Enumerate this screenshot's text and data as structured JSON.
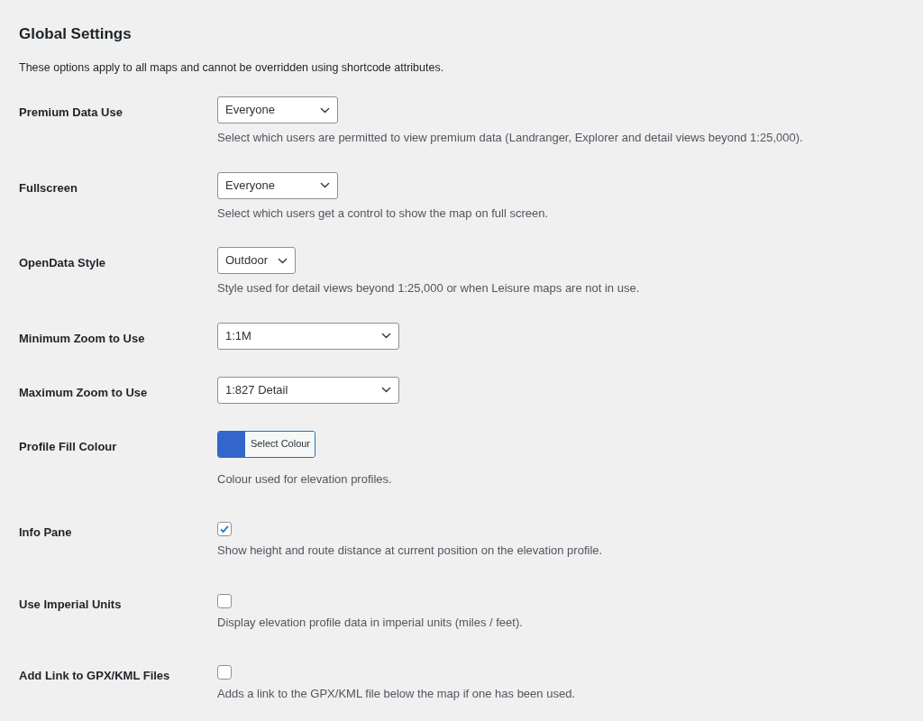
{
  "title": "Global Settings",
  "intro": "These options apply to all maps and cannot be overridden using shortcode attributes.",
  "settings": [
    {
      "kind": "select",
      "label": "Premium Data Use",
      "value": "Everyone",
      "description": "Select which users are permitted to view premium data (Landranger, Explorer and detail views beyond 1:25,000)."
    },
    {
      "kind": "select",
      "label": "Fullscreen",
      "value": "Everyone",
      "description": "Select which users get a control to show the map on full screen."
    },
    {
      "kind": "select",
      "label": "OpenData Style",
      "value": "Outdoor",
      "description": "Style used for detail views beyond 1:25,000 or when Leisure maps are not in use."
    },
    {
      "kind": "select",
      "label": "Minimum Zoom to Use",
      "value": "1:1M"
    },
    {
      "kind": "select",
      "label": "Maximum Zoom to Use",
      "value": "1:827 Detail"
    },
    {
      "kind": "color",
      "label": "Profile Fill Colour",
      "button": "Select Colour",
      "color": "#3366cc",
      "description": "Colour used for elevation profiles."
    },
    {
      "kind": "checkbox",
      "label": "Info Pane",
      "checked": true,
      "description": "Show height and route distance at current position on the elevation profile."
    },
    {
      "kind": "checkbox",
      "label": "Use Imperial Units",
      "checked": false,
      "description": "Display elevation profile data in imperial units (miles / feet)."
    },
    {
      "kind": "checkbox",
      "label": "Add Link to GPX/KML Files",
      "checked": false,
      "description": "Adds a link to the GPX/KML file below the map if one has been used."
    }
  ]
}
